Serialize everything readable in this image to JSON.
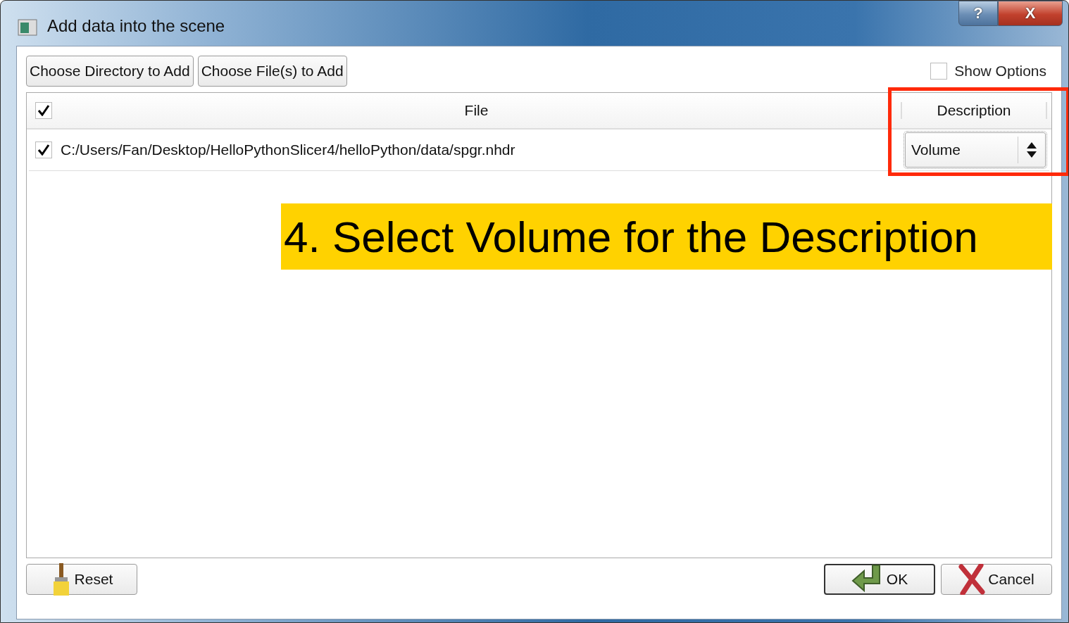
{
  "window": {
    "title": "Add data into the scene"
  },
  "title_buttons": [
    {
      "kind": "help",
      "label": "?"
    },
    {
      "kind": "close",
      "label": "X"
    }
  ],
  "toolbar": {
    "buttons": [
      "Choose Directory to Add",
      "Choose File(s) to Add"
    ],
    "show_options": {
      "label": "Show Options",
      "checked": false
    }
  },
  "table": {
    "header_checked": true,
    "columns": [
      "File",
      "Description"
    ],
    "rows": [
      {
        "checked": true,
        "file": "C:/Users/Fan/Desktop/HelloPythonSlicer4/helloPython/data/spgr.nhdr",
        "description": "Volume"
      }
    ]
  },
  "annotation": {
    "text": "4. Select Volume for the Description"
  },
  "footer": {
    "buttons": [
      {
        "kind": "reset",
        "label": "Reset",
        "default": false
      },
      {
        "kind": "ok",
        "label": "OK",
        "default": true
      },
      {
        "kind": "cancel",
        "label": "Cancel",
        "default": false
      }
    ]
  }
}
